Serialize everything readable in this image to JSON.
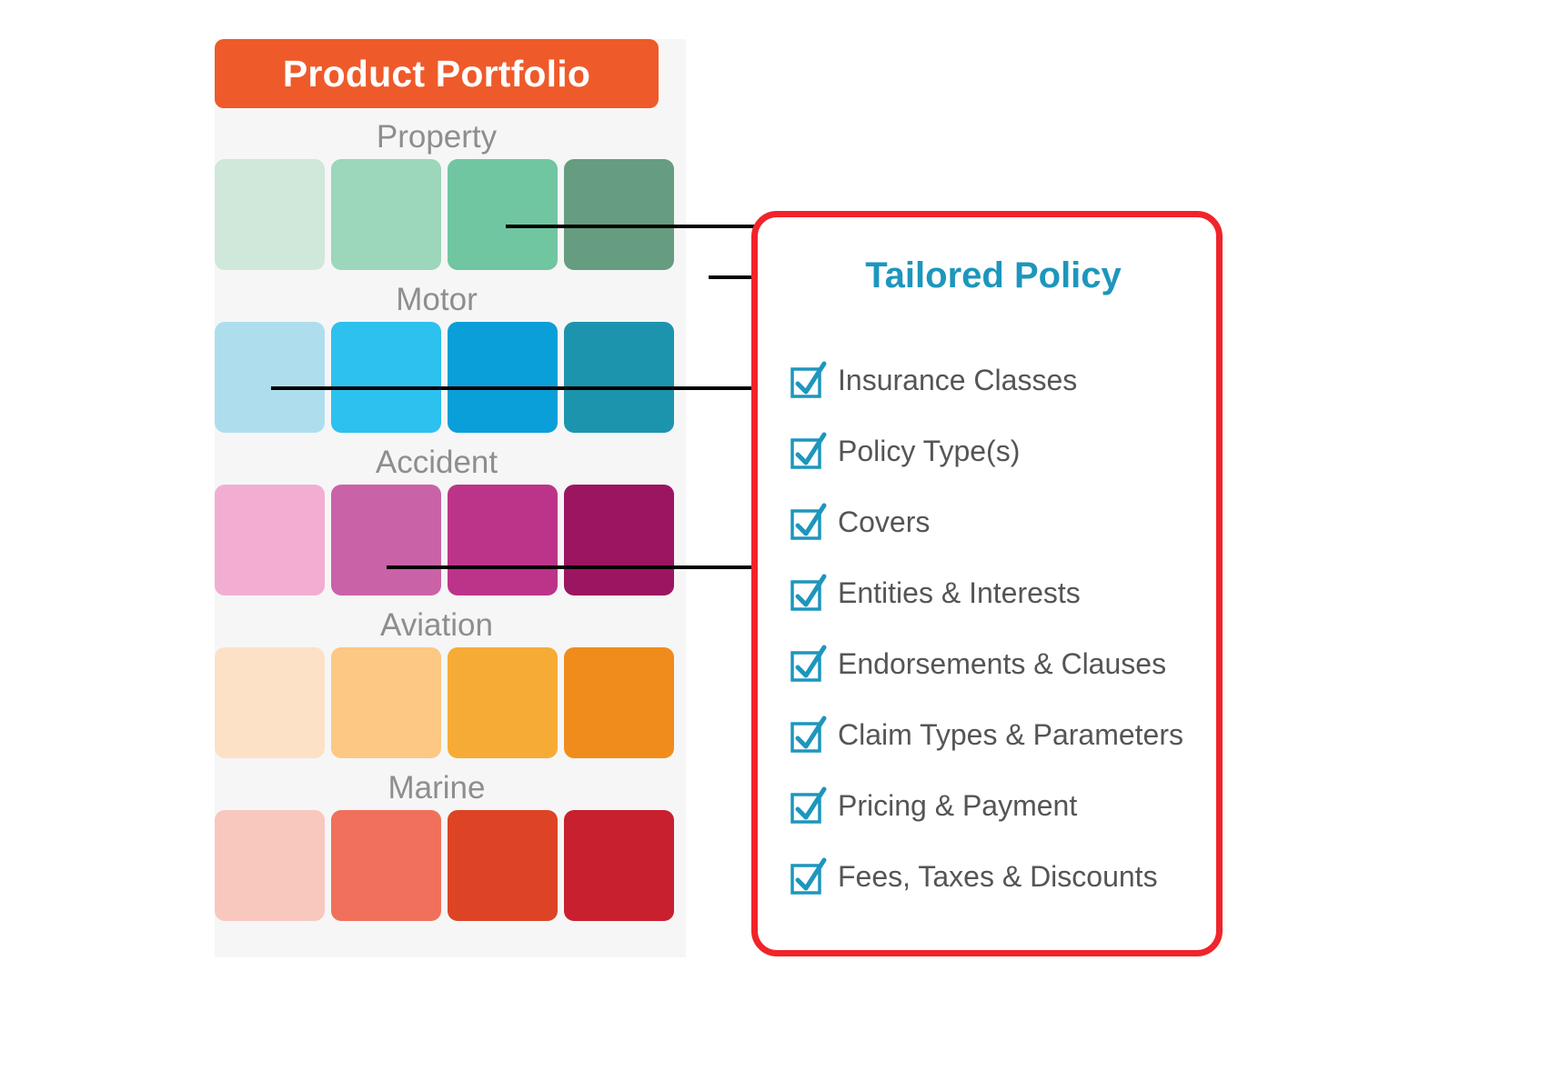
{
  "portfolio": {
    "header_title": "Product Portfolio",
    "header_color": "#ef5a2a",
    "panel_bg": "#f6f6f6",
    "label_color": "#8e8e8e",
    "categories": [
      {
        "label": "Property",
        "swatches": [
          "#cfe8d9",
          "#9cd6bb",
          "#6fc6a0",
          "#669c80"
        ]
      },
      {
        "label": "Motor",
        "swatches": [
          "#aedeee",
          "#2cc1ee",
          "#0a9fd9",
          "#1d94ae"
        ]
      },
      {
        "label": "Accident",
        "swatches": [
          "#f2aed2",
          "#ca62a8",
          "#bc3489",
          "#9c1560"
        ]
      },
      {
        "label": "Aviation",
        "swatches": [
          "#fce1c6",
          "#fcc883",
          "#f7ab37",
          "#f08c1b"
        ]
      },
      {
        "label": "Marine",
        "swatches": [
          "#f8c8bf",
          "#f1705b",
          "#dc4425",
          "#c8202f"
        ]
      }
    ]
  },
  "connectors": {
    "line_color": "#000000",
    "arrow_label": "arrow-to-tailored-policy"
  },
  "policy": {
    "border_color": "#f0242a",
    "title": "Tailored Policy",
    "title_color": "#1d96bd",
    "check_color": "#1d96bd",
    "label_color": "#555555",
    "items": [
      {
        "label": "Insurance Classes",
        "icon": "checkbox-checked-icon"
      },
      {
        "label": "Policy Type(s)",
        "icon": "checkbox-checked-icon"
      },
      {
        "label": "Covers",
        "icon": "checkbox-checked-icon"
      },
      {
        "label": "Entities & Interests",
        "icon": "checkbox-checked-icon"
      },
      {
        "label": "Endorsements & Clauses",
        "icon": "checkbox-checked-icon"
      },
      {
        "label": "Claim Types & Parameters",
        "icon": "checkbox-checked-icon"
      },
      {
        "label": "Pricing & Payment",
        "icon": "checkbox-checked-icon"
      },
      {
        "label": "Fees, Taxes & Discounts",
        "icon": "checkbox-checked-icon"
      }
    ]
  }
}
